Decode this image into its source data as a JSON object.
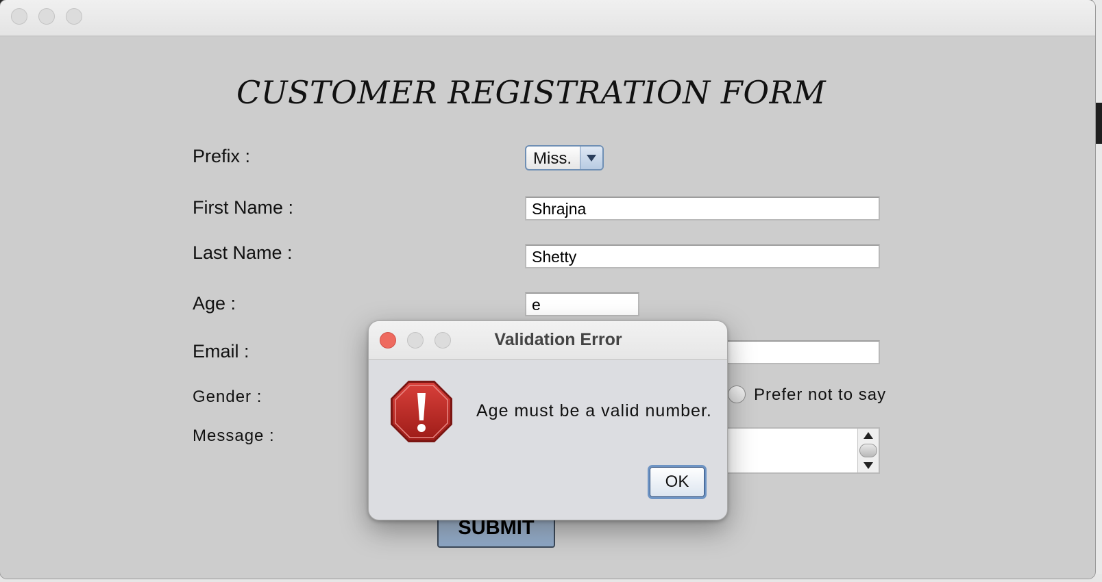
{
  "form": {
    "title": "CUSTOMER REGISTRATION FORM",
    "labels": {
      "prefix": "Prefix :",
      "first_name": "First Name :",
      "last_name": "Last Name :",
      "age": "Age :",
      "email": "Email :",
      "gender": "Gender :",
      "message": "Message :"
    },
    "prefix_value": "Miss.",
    "first_name_value": "Shrajna",
    "last_name_value": "Shetty",
    "age_value": "e",
    "email_value": "",
    "gender_option_visible": "Prefer not to say",
    "submit_label": "SUBMIT"
  },
  "dialog": {
    "title": "Validation Error",
    "message": "Age must be a valid number.",
    "ok_label": "OK",
    "icon": "error-stop-icon"
  },
  "colors": {
    "window_bg": "#cdcdcd",
    "close_red": "#ee6a5f",
    "error_red": "#b8231e",
    "button_blue": "#8ea8c7"
  }
}
